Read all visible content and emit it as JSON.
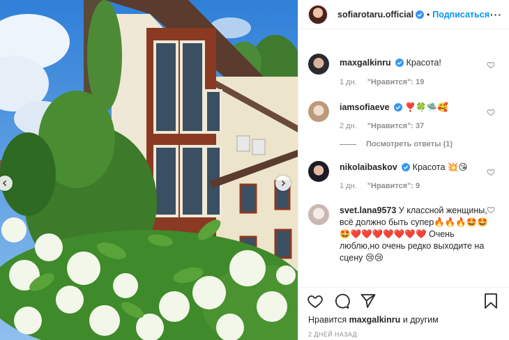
{
  "header": {
    "username": "sofiarotaru.official",
    "separator": "•",
    "follow_label": "Подписаться",
    "more_label": "···"
  },
  "comments": [
    {
      "username": "maxgalkinru",
      "verified": true,
      "text": "Красота!",
      "time": "1 дн.",
      "likes": "\"Нравится\": 19"
    },
    {
      "username": "iamsofiaeve",
      "verified": true,
      "text": "❣️🍀🛸🥰",
      "time": "2 дн.",
      "likes": "\"Нравится\": 37",
      "replies_label": "Посмотреть ответы (1)"
    },
    {
      "username": "nikolaibaskov",
      "verified": true,
      "text": "Красота 💥😘",
      "time": "1 дн.",
      "likes": "\"Нравится\": 9"
    },
    {
      "username": "svet.lana9573",
      "verified": false,
      "text": "У классной женщины, всё должно быть супер🔥🔥🔥🤩🤩🤩❤️❤️❤️❤️❤️❤️❤️ Очень люблю,но очень редко выходите на сцену 😢😢"
    }
  ],
  "footer": {
    "liked_prefix": "Нравится",
    "liked_user": "maxgalkinru",
    "liked_suffix": "и другим",
    "date": "2 дней назад"
  },
  "colors": {
    "link_blue": "#0095f6",
    "verified_blue": "#3897f0",
    "meta_gray": "#8e8e8e"
  },
  "icons": {
    "photo_prev": "chevron-left-icon",
    "photo_next": "chevron-right-icon",
    "verified": "verified-badge-icon",
    "comment_like": "heart-outline-icon",
    "like": "heart-icon",
    "comment": "comment-bubble-icon",
    "share": "paper-plane-icon",
    "save": "bookmark-icon"
  }
}
